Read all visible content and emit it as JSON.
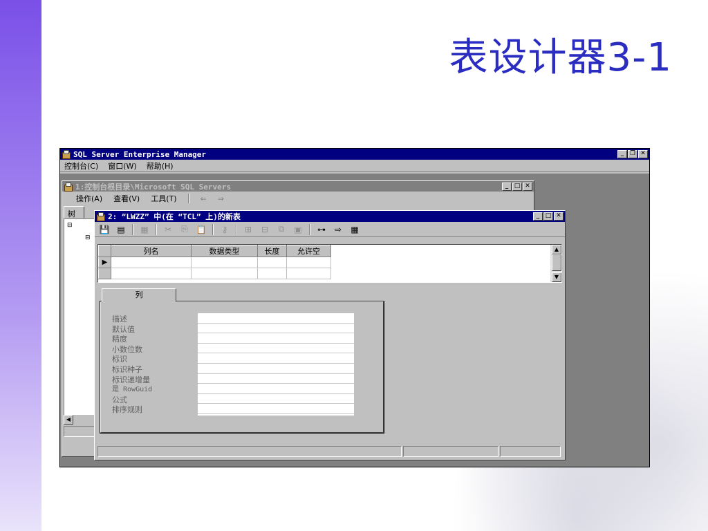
{
  "slide": {
    "title": "表设计器3-1"
  },
  "app": {
    "title": "SQL Server Enterprise Manager",
    "menu": [
      "控制台(C)",
      "窗口(W)",
      "帮助(H)"
    ],
    "window_buttons": {
      "minimize": "_",
      "restore": "❐",
      "close": "✕"
    }
  },
  "console": {
    "title": "1:控制台根目录\\Microsoft SQL Servers",
    "toolbar": [
      "操作(A)",
      "查看(V)",
      "工具(T)"
    ],
    "nav": {
      "back": "⇐",
      "forward": "⇒"
    },
    "tree_tab": "树"
  },
  "designer": {
    "title": "2: “LWZZ” 中(在 “TCL” 上)的新表",
    "grid": {
      "columns": [
        "列名",
        "数据类型",
        "长度",
        "允许空"
      ],
      "rows": [
        {
          "indicator": "▶",
          "cells": [
            "",
            "",
            "",
            ""
          ]
        },
        {
          "indicator": "",
          "cells": [
            "",
            "",
            "",
            ""
          ]
        }
      ]
    },
    "tab_label": "列",
    "properties": [
      "描述",
      "默认值",
      "精度",
      "小数位数",
      "标识",
      "标识种子",
      "标识递增量",
      "是 RowGuid",
      "公式",
      "排序规则"
    ],
    "toolbar_icons": [
      "save-icon",
      "properties-icon",
      "insert-column-icon",
      "cut-icon",
      "copy-icon",
      "paste-icon",
      "key-icon",
      "insert-row-icon",
      "delete-row-icon",
      "manage-indexes-icon",
      "manage-constraints-icon",
      "relationships-icon",
      "generate-script-icon",
      "grid-view-icon"
    ]
  }
}
